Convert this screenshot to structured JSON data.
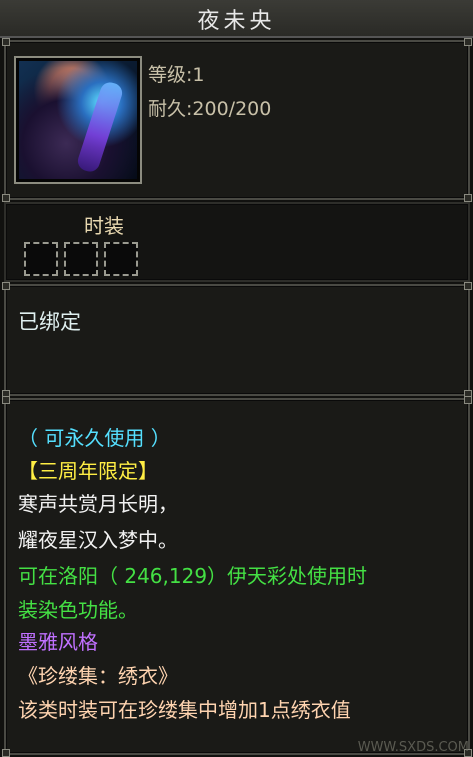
{
  "item": {
    "name": "夜未央",
    "level": "等级:1",
    "durability": "耐久:200/200",
    "category": "时装",
    "bound_status": "已绑定"
  },
  "description": {
    "usage": "（ 可永久使用 ）",
    "event_tag": "【三周年限定】",
    "poem_line1": "寒声共赏月长明，",
    "poem_line2": "耀夜星汉入梦中。",
    "dye_info_line1": "可在洛阳（ 246,129）伊天彩处使用时",
    "dye_info_line2": "装染色功能。",
    "style": "墨雅风格",
    "collection": "《珍缕集：绣衣》",
    "collection_bonus": "该类时装可在珍缕集中增加1点绣衣值"
  },
  "watermark": "WWW.SXDS.COM",
  "colors": {
    "usage": "#55e0ff",
    "event_tag": "#ffee44",
    "poem": "#f2f2f2",
    "dye_info": "#44e044",
    "style": "#c070ff",
    "collection": "#ffd4b0"
  }
}
